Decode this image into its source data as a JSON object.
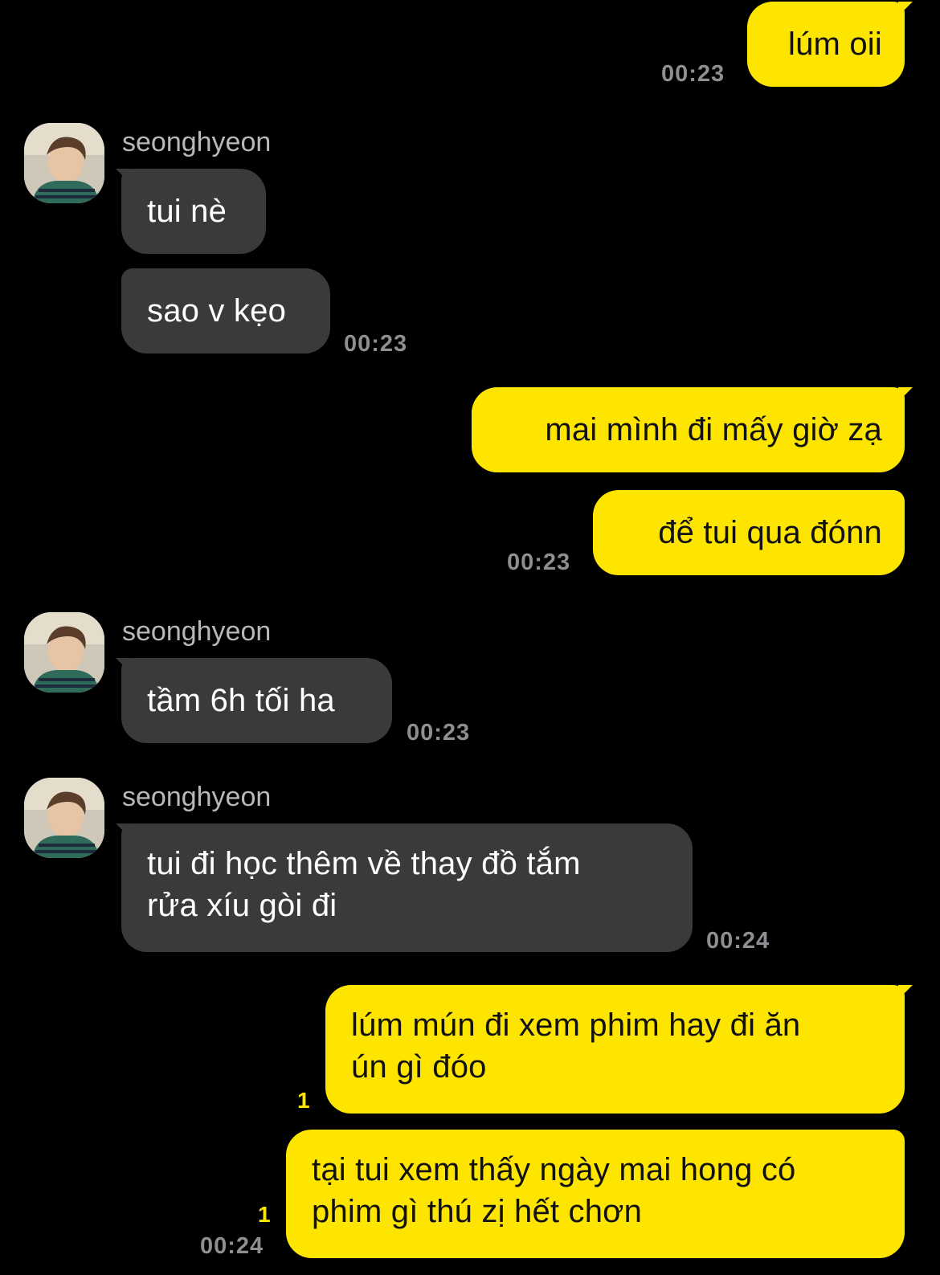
{
  "colors": {
    "background": "#000000",
    "my_bubble": "#FEE500",
    "their_bubble": "#3a3a3c",
    "timestamp": "#8e8e93",
    "unread": "#FEE500"
  },
  "messages": {
    "m1": {
      "text": "lúm oii",
      "time": "00:23"
    },
    "g1": {
      "sender": "seonghyeon",
      "avatar": "profile-photo",
      "b1": "tui nè",
      "b2": "sao v kẹo",
      "time": "00:23"
    },
    "m2": {
      "b1": "mai mình đi mấy giờ zạ",
      "b2": "để tui qua đónn",
      "time": "00:23"
    },
    "g2": {
      "sender": "seonghyeon",
      "avatar": "profile-photo",
      "b1": "tầm 6h tối ha",
      "time": "00:23"
    },
    "g3": {
      "sender": "seonghyeon",
      "avatar": "profile-photo",
      "line1": "tui đi học thêm về thay đồ tắm",
      "line2": "rửa xíu gòi đi",
      "time": "00:24"
    },
    "m3": {
      "b1_line1": "lúm mún đi xem phim hay đi ăn",
      "b1_line2": "ún gì đóo",
      "b1_unread": "1",
      "b2_line1": "tại tui xem thấy ngày mai hong có",
      "b2_line2": "phim gì thú zị hết chơn",
      "b2_unread": "1",
      "time": "00:24"
    }
  }
}
